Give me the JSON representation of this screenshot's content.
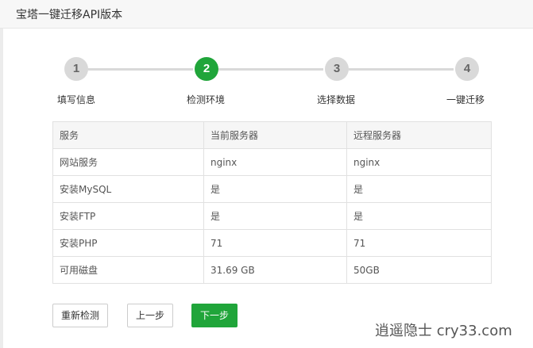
{
  "dialog": {
    "title": "宝塔一键迁移API版本"
  },
  "steps": [
    {
      "number": "1",
      "label": "填写信息",
      "active": false
    },
    {
      "number": "2",
      "label": "检测环境",
      "active": true
    },
    {
      "number": "3",
      "label": "选择数据",
      "active": false
    },
    {
      "number": "4",
      "label": "一键迁移",
      "active": false
    }
  ],
  "table": {
    "headers": [
      "服务",
      "当前服务器",
      "远程服务器"
    ],
    "rows": [
      [
        "网站服务",
        "nginx",
        "nginx"
      ],
      [
        "安装MySQL",
        "是",
        "是"
      ],
      [
        "安装FTP",
        "是",
        "是"
      ],
      [
        "安装PHP",
        "71",
        "71"
      ],
      [
        "可用磁盘",
        "31.69 GB",
        "50GB"
      ]
    ]
  },
  "buttons": {
    "recheck": "重新检测",
    "prev": "上一步",
    "next": "下一步"
  },
  "colors": {
    "accent": "#20a53a",
    "inactive_step": "#d9d9d9"
  },
  "watermark": "逍遥隐士 cry33.com"
}
